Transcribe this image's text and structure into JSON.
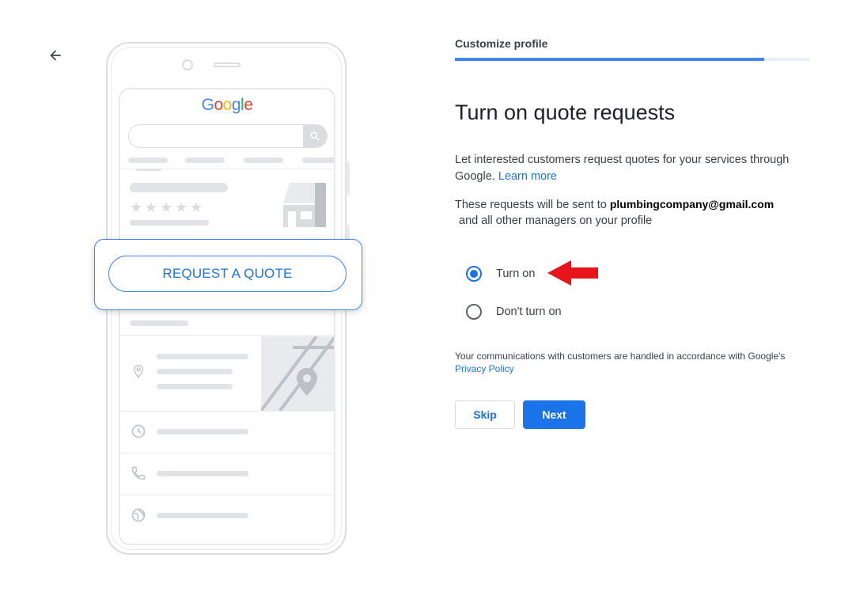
{
  "nav": {
    "back_icon": "arrow-back-icon"
  },
  "illustration": {
    "logo_letters": [
      {
        "ch": "G",
        "color": "#4285f4"
      },
      {
        "ch": "o",
        "color": "#ea4335"
      },
      {
        "ch": "o",
        "color": "#fbbc05"
      },
      {
        "ch": "g",
        "color": "#4285f4"
      },
      {
        "ch": "l",
        "color": "#34a853"
      },
      {
        "ch": "e",
        "color": "#ea4335"
      }
    ],
    "quote_button_label": "REQUEST A QUOTE"
  },
  "progress": {
    "step_label": "Customize profile",
    "fraction": 0.87
  },
  "content": {
    "heading": "Turn on quote requests",
    "description": "Let interested customers request quotes for your services through Google.",
    "learn_more": "Learn more",
    "sent_prefix": "These requests will be sent to",
    "email": "plumbingcompany@gmail.com",
    "sent_suffix": "and all other managers on your profile"
  },
  "options": [
    {
      "label": "Turn on",
      "checked": true
    },
    {
      "label": "Don't turn on",
      "checked": false
    }
  ],
  "footnote": {
    "text": "Your communications with customers are handled in accordance with Google's",
    "link": "Privacy Policy"
  },
  "actions": {
    "skip_label": "Skip",
    "next_label": "Next"
  },
  "colors": {
    "accent": "#1a73e8",
    "annotation_arrow": "#e8141c"
  }
}
